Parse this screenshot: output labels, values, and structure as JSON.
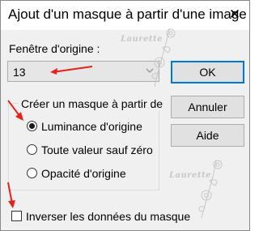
{
  "window": {
    "title": "Ajout d'un masque à partir d'une image",
    "close_glyph": "✕"
  },
  "source": {
    "label": "Fenêtre d'origine :",
    "value": "13"
  },
  "buttons": {
    "ok": "OK",
    "cancel": "Annuler",
    "help": "Aide"
  },
  "create_group": {
    "legend": "Créer un masque à partir de",
    "options": [
      {
        "label": "Luminance d'origine",
        "selected": true
      },
      {
        "label": "Toute valeur sauf zéro",
        "selected": false
      },
      {
        "label": "Opacité d'origine",
        "selected": false
      }
    ]
  },
  "invert": {
    "label": "Inverser les données du masque",
    "checked": false
  },
  "watermark": {
    "text": "Laurette",
    "color": "#c8c8c8"
  },
  "annotations": {
    "arrow_color": "#e8211b"
  }
}
